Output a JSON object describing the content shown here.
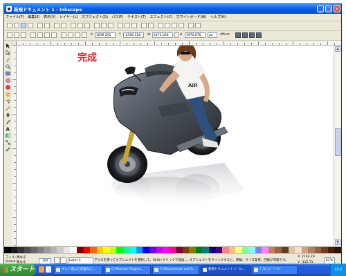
{
  "window": {
    "title": "新規ドキュメント 1 - Inkscape",
    "minimize_glyph": "_",
    "maximize_glyph": "□",
    "close_glyph": "×"
  },
  "menubar": {
    "items": [
      "ファイル(F)",
      "編集(E)",
      "表示(V)",
      "レイヤー(L)",
      "オブジェクト(O)",
      "パス(P)",
      "テキスト(T)",
      "エフェクト(C)",
      "ホワイトボード(W)",
      "ヘルプ(H)"
    ]
  },
  "toolbar2": {
    "x_label": "X",
    "x_value": "1839.291",
    "y_label": "Y",
    "y_value": "-2366.118",
    "w_label": "W",
    "w_value": "2475.006",
    "h_label": "H",
    "h_value": "1970.076",
    "unit": "px",
    "affect_label": "Affect:"
  },
  "canvas": {
    "done_text": "完成"
  },
  "status": {
    "fill_label": "フィル:",
    "fill_value": "異なる",
    "stroke_label": "Stroke:",
    "stroke_value": "異なる",
    "opacity_value": "100",
    "layer_value": "Layer 1",
    "message": "マウスを使ってオブジェクトを選択して、Shift+クリックで追加..., オブジェクトをクリックすると、移動、サイズ変更、回転が可能です。",
    "x_coord": "X: 2164.29",
    "y_coord": "Y: -115.71",
    "zoom": "21%"
  },
  "taskbar": {
    "start_label": "スタート",
    "tasks": [
      "ネット遊んだ記録など...",
      "D:¥Human Plugins...",
      "C:¥Documents and S...",
      "新規ドキュメント 1 - In...",
      "ﾃﾞｽｸﾄｯﾌﾟ ﾍﾟｲﾝﾄ"
    ],
    "clock": "15:2"
  },
  "colors": {
    "title_blue": "#0a5ee8",
    "chrome": "#ece9d8",
    "done_red": "#d8262a",
    "start_green": "#3d9a3d"
  },
  "palette": [
    "#000000",
    "#1a1a1a",
    "#333333",
    "#4d4d4d",
    "#666666",
    "#808080",
    "#999999",
    "#b3b3b3",
    "#cccccc",
    "#e6e6e6",
    "#ffffff",
    "#800000",
    "#ff0000",
    "#ff6600",
    "#ffcc00",
    "#ffff00",
    "#ccff00",
    "#00ff00",
    "#00ff99",
    "#00ffff",
    "#0099ff",
    "#0000ff",
    "#6600ff",
    "#cc00ff",
    "#ff00ff",
    "#ff0099",
    "#800040",
    "#804000",
    "#808000",
    "#008000",
    "#008080",
    "#000080",
    "#400080",
    "#ff8080",
    "#ffbf80",
    "#ffff80",
    "#80ff80",
    "#80ffff",
    "#8080ff",
    "#ff80ff",
    "#c08060",
    "#a06040",
    "#604020",
    "#e0c0a0",
    "#f0e0d0",
    "#d0a080",
    "#b08060",
    "#906040",
    "#704020",
    "#502000",
    "#301000"
  ]
}
